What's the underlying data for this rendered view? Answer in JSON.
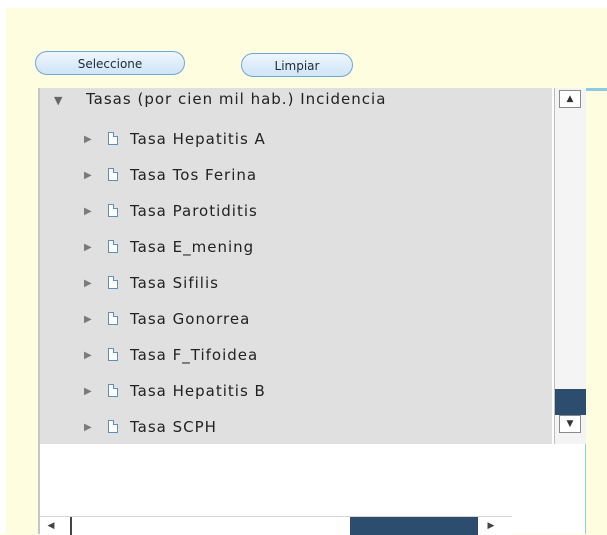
{
  "toolbar": {
    "select_label": "Seleccione",
    "clear_label": "Limpiar"
  },
  "tree": {
    "root_label": "Tasas (por cien mil hab.) Incidencia",
    "items": [
      {
        "label": "Tasa Hepatitis A"
      },
      {
        "label": "Tasa Tos Ferina"
      },
      {
        "label": "Tasa Parotiditis"
      },
      {
        "label": "Tasa E_mening"
      },
      {
        "label": "Tasa Sifilis"
      },
      {
        "label": "Tasa Gonorrea"
      },
      {
        "label": "Tasa F_Tifoidea"
      },
      {
        "label": "Tasa Hepatitis B"
      },
      {
        "label": "Tasa SCPH"
      }
    ]
  },
  "icons": {
    "expanded": "triangle-down-icon",
    "collapsed": "triangle-right-icon",
    "document": "document-icon"
  },
  "colors": {
    "page_background": "#fffde0",
    "tree_background": "#e0e0e0",
    "scroll_thumb": "#2d4d6e",
    "frame_line": "#8ccbe2"
  }
}
